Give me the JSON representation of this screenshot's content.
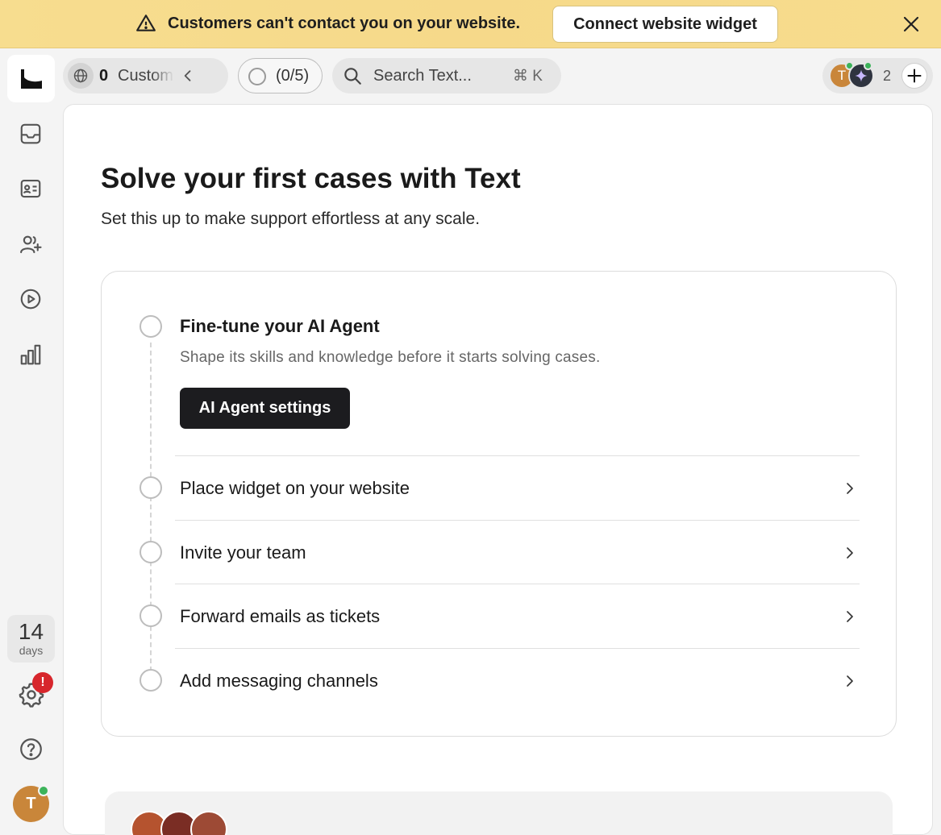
{
  "banner": {
    "message": "Customers can't contact you on your website.",
    "button_label": "Connect website widget",
    "icons": {
      "warning": "warning-triangle-icon",
      "close": "close-icon"
    },
    "background_color": "#f7dd8f"
  },
  "sidebar": {
    "nav_icons": [
      "inbox-icon",
      "contact-card-icon",
      "add-user-icon",
      "play-circle-icon",
      "bar-chart-icon"
    ],
    "trial": {
      "number": "14",
      "unit": "days"
    },
    "settings_alert": "!",
    "user_initial": "T"
  },
  "toolbar": {
    "customers": {
      "count": "0",
      "label": "Customers"
    },
    "progress": {
      "label": "(0/5)"
    },
    "search": {
      "placeholder": "Search Text...",
      "shortcut": "⌘ K"
    },
    "team": {
      "avatar_initial": "T",
      "count": "2"
    }
  },
  "main": {
    "title": "Solve your first cases with Text",
    "subtitle": "Set this up to make support effortless at any scale.",
    "steps": [
      {
        "title": "Fine-tune your AI Agent",
        "description": "Shape its skills and knowledge before it starts solving cases.",
        "button_label": "AI Agent settings"
      },
      {
        "title": "Place widget on your website"
      },
      {
        "title": "Invite your team"
      },
      {
        "title": "Forward emails as tickets"
      },
      {
        "title": "Add messaging channels"
      }
    ]
  },
  "colors": {
    "primary_button": "#1c1c1f",
    "online_status": "#3cb35a",
    "alert": "#d7262c",
    "avatar": "#c9863a"
  }
}
